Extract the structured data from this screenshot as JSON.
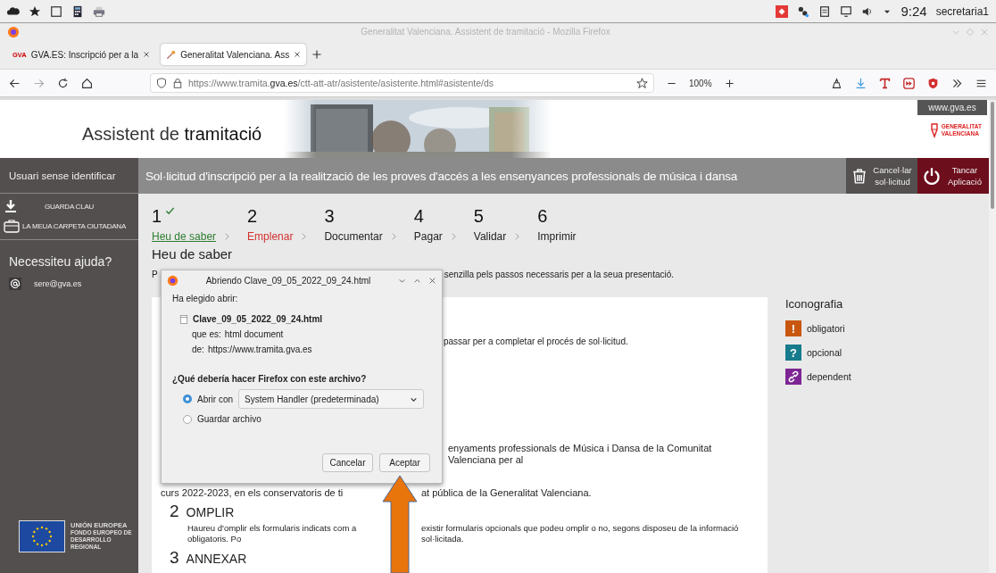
{
  "system_bar": {
    "clock": "9:24",
    "user": "secretaria1"
  },
  "window": {
    "title": "Generalitat Valenciana. Assistent de tramitació - Mozilla Firefox"
  },
  "tabs": [
    {
      "favicon_text": "GVA",
      "label": "GVA.ES: Inscripció per a la",
      "selected": false
    },
    {
      "label": "Generalitat Valenciana. Ass",
      "selected": true
    }
  ],
  "address_bar": {
    "url_start": "https://www.tramita.",
    "url_domain": "gva.es",
    "url_end": "/ctt-att-atr/asistente/asistente.html#asistente/ds",
    "zoom": "100%"
  },
  "site": {
    "title": "Assistent de **tramitació**",
    "portal_link": "www.gva.es",
    "logo_lines": [
      "GENERALITAT",
      "VALENCIANA"
    ]
  },
  "sidebar": {
    "user": "Usuari sense identificar",
    "actions": [
      {
        "kind": "download",
        "label": "GUARDA CLAU"
      },
      {
        "kind": "folder",
        "label": "LA MEUA CARPETA CIUTADANA"
      }
    ],
    "help_title": "Necessiteu ajuda?",
    "email": "sere@gva.es",
    "eu": {
      "title": "UNIÓN EUROPEA",
      "subtitle_lines": [
        "FONDO EUROPEO DE",
        "DESARROLLO REGIONAL"
      ]
    }
  },
  "procedure": {
    "title": "Sol·licitud d'inscripció per a la realització de les proves d'accés a les ensenyances professionals de música i dansa",
    "cancel": "Cancel·lar sol·licitud",
    "close": "Tancar Aplicació"
  },
  "steps": [
    {
      "number": "1",
      "label": "Heu de saber",
      "completed": true,
      "selected": false
    },
    {
      "number": "2",
      "label": "Emplenar",
      "completed": false,
      "selected": true
    },
    {
      "number": "3",
      "label": "Documentar",
      "completed": false,
      "selected": false
    },
    {
      "number": "4",
      "label": "Pagar",
      "completed": false,
      "selected": false
    },
    {
      "number": "5",
      "label": "Validar",
      "completed": false,
      "selected": false
    },
    {
      "number": "6",
      "label": "Imprimir",
      "completed": false,
      "selected": false
    }
  ],
  "section": {
    "heading": "Heu de saber",
    "intro_start": "P",
    "intro_end": "senzilla pels passos necessaris per a la seua presentació."
  },
  "card": {
    "line_a": "passar per a completar el procés de sol·licitud.",
    "line_b": "enyaments professionals de Música i Dansa de la Comunitat Valenciana per al",
    "line_c_start": "curs 2022-2023, en els conservatoris de ti",
    "line_c_end": "at pública de la Generalitat Valenciana.",
    "sections": [
      {
        "number": "2",
        "title": "OMPLIR",
        "text_start": "Haureu d'omplir els formularis indicats com a obligatoris. Po",
        "text_end": "existir formularis opcionals que podeu omplir o no, segons disposeu de la informació sol·licitada."
      },
      {
        "number": "3",
        "title": "ANNEXAR"
      }
    ]
  },
  "legend": {
    "title": "Iconografia",
    "items": [
      {
        "kind": "symbol",
        "symbol": "!",
        "label": "obligatori",
        "color": "#c9560f"
      },
      {
        "kind": "symbol",
        "symbol": "?",
        "label": "opcional",
        "color": "#167b8d"
      },
      {
        "kind": "link",
        "label": "dependent",
        "color": "#7d2594"
      }
    ]
  },
  "dialog": {
    "title": "Abriendo Clave_09_05_2022_09_24.html",
    "intro": "Ha elegido abrir:",
    "file": "Clave_09_05_2022_09_24.html",
    "type_label": "que es:",
    "type_value": "html document",
    "from_label": "de:",
    "from_value": "https://www.tramita.gva.es",
    "question": "¿Qué debería hacer Firefox con este archivo?",
    "options": [
      {
        "label": "Abrir con",
        "selected": true
      },
      {
        "label": "Guardar archivo",
        "selected": false
      }
    ],
    "handler": "System Handler (predeterminada)",
    "buttons": [
      "Cancelar",
      "Aceptar"
    ]
  }
}
